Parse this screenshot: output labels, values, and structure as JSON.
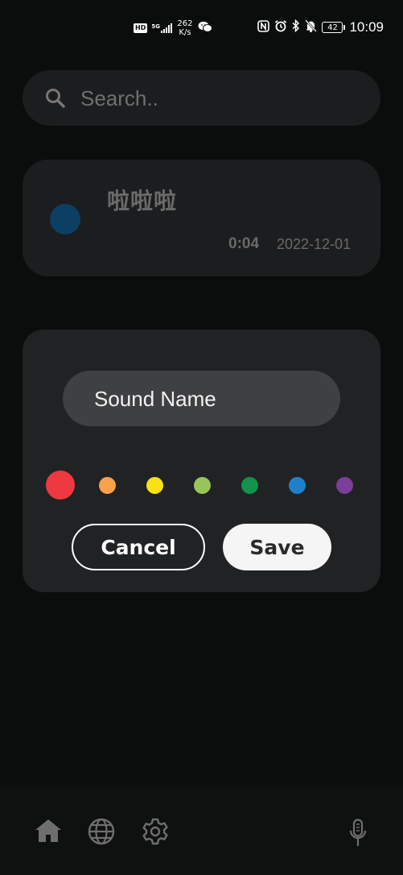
{
  "status_bar": {
    "hd_badge": "HD",
    "network_type": "5G",
    "network_speed_value": "262",
    "network_speed_unit": "K/s",
    "battery_level": "42",
    "time": "10:09"
  },
  "search": {
    "placeholder": "Search.."
  },
  "recording": {
    "title": "啦啦啦",
    "duration": "0:04",
    "date": "2022-12-01",
    "color": "#0b3f63"
  },
  "dialog": {
    "name_placeholder": "Sound Name",
    "colors": [
      {
        "name": "red",
        "hex": "#ee3940",
        "selected": true
      },
      {
        "name": "orange",
        "hex": "#f8a24a",
        "selected": false
      },
      {
        "name": "yellow",
        "hex": "#fbe014",
        "selected": false
      },
      {
        "name": "light-green",
        "hex": "#96c65a",
        "selected": false
      },
      {
        "name": "green",
        "hex": "#12924a",
        "selected": false
      },
      {
        "name": "blue",
        "hex": "#1f82c8",
        "selected": false
      },
      {
        "name": "purple",
        "hex": "#7a3f9a",
        "selected": false
      }
    ],
    "cancel_label": "Cancel",
    "save_label": "Save"
  },
  "bottom_nav": {
    "items": [
      "home-icon",
      "globe-icon",
      "gear-icon",
      "microphone-icon"
    ],
    "icon_color": "#6e6e6e"
  }
}
